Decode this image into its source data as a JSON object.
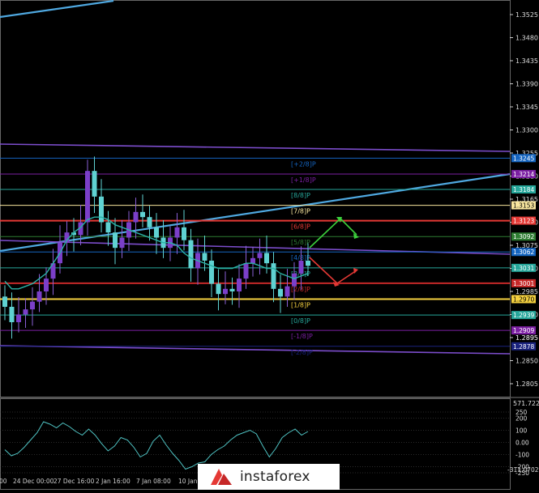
{
  "chart_data": [
    {
      "type": "candlestick",
      "instrument_note": "",
      "ylim": [
        1.2805,
        1.3545
      ],
      "price_scale": [
        "1.3525",
        "1.3480",
        "1.3435",
        "1.3390",
        "1.3345",
        "1.3300",
        "1.3255",
        "1.3210",
        "1.3165",
        "1.3120",
        "1.3075",
        "1.3030",
        "1.2985",
        "1.2940",
        "1.2895",
        "1.2850",
        "1.2805"
      ],
      "x_labels": [
        "24 Dec 00:00",
        "27 Dec 16:00",
        "2 Jan 16:00",
        "7 Jan 08:00",
        "10 Jan"
      ],
      "x_label_cut": "00",
      "murrey_levels": [
        {
          "label": "[+2/8]P",
          "price": 1.3245,
          "tag": "1.3245",
          "color": "#1565c0"
        },
        {
          "label": "[+1/8]P",
          "price": 1.3214,
          "tag": "1.3214",
          "color": "#7b1fa2"
        },
        {
          "label": "[8/8]P",
          "price": 1.3184,
          "tag": "1.3184",
          "color": "#26a69a"
        },
        {
          "label": "[7/8]P",
          "price": 1.3153,
          "tag": "1.3153",
          "color": "#f9e79f"
        },
        {
          "label": "[6/8]P",
          "price": 1.3123,
          "tag": "1.3123",
          "color": "#e53935"
        },
        {
          "label": "[5/8]P",
          "price": 1.3092,
          "tag": "1.3092",
          "color": "#2e7d32"
        },
        {
          "label": "[4/8]P",
          "price": 1.3062,
          "tag": "1.3062",
          "color": "#1565c0"
        },
        {
          "label": "[3/8]P",
          "price": 1.3031,
          "tag": "1.3031",
          "color": "#26a69a"
        },
        {
          "label": "[2/8]P",
          "price": 1.3001,
          "tag": "1.3001",
          "color": "#c62828"
        },
        {
          "label": "[1/8]P",
          "price": 1.297,
          "tag": "1.2970",
          "color": "#f4d03f"
        },
        {
          "label": "[0/8]P",
          "price": 1.2939,
          "tag": "1.2939",
          "color": "#26a69a"
        },
        {
          "label": "[-1/8]P",
          "price": 1.2909,
          "tag": "1.2909",
          "color": "#7b1fa2"
        },
        {
          "label": "[-2/8]P",
          "price": 1.2878,
          "tag": "1.2878",
          "color": "#1a237e"
        }
      ],
      "candles_close": [
        1.2955,
        1.2925,
        1.294,
        1.295,
        1.2965,
        1.2985,
        1.301,
        1.304,
        1.308,
        1.31,
        1.3095,
        1.312,
        1.322,
        1.317,
        1.312,
        1.31,
        1.307,
        1.309,
        1.312,
        1.314,
        1.313,
        1.311,
        1.309,
        1.307,
        1.309,
        1.311,
        1.3085,
        1.303,
        1.306,
        1.3045,
        1.3,
        1.298,
        1.299,
        1.2985,
        1.301,
        1.304,
        1.305,
        1.306,
        1.304,
        1.299,
        1.2975,
        1.2995,
        1.302,
        1.3045,
        1.3035
      ],
      "moving_average": [
        1.3005,
        1.299,
        1.299,
        1.2995,
        1.3,
        1.301,
        1.302,
        1.304,
        1.306,
        1.3085,
        1.31,
        1.311,
        1.3125,
        1.313,
        1.313,
        1.3125,
        1.3115,
        1.311,
        1.3105,
        1.31,
        1.3095,
        1.309,
        1.3085,
        1.308,
        1.308,
        1.3075,
        1.306,
        1.305,
        1.3045,
        1.304,
        1.3035,
        1.303,
        1.303,
        1.303,
        1.3035,
        1.304,
        1.304,
        1.3035,
        1.303,
        1.303,
        1.302,
        1.3015,
        1.301,
        1.3015,
        1.302
      ]
    },
    {
      "type": "line",
      "indicator": "cci",
      "header_value": "571.7224",
      "footer_value": "-311.0702",
      "ylim": [
        -311.07,
        571.72
      ],
      "y_ticks": [
        "250",
        "200",
        "100",
        "0.00",
        "-100",
        "-200",
        "-250"
      ],
      "values": [
        -60,
        -110,
        -90,
        -40,
        20,
        80,
        170,
        150,
        120,
        160,
        130,
        90,
        60,
        110,
        60,
        -10,
        -70,
        -30,
        40,
        20,
        -40,
        -120,
        -90,
        10,
        60,
        -20,
        -90,
        -150,
        -220,
        -200,
        -170,
        -160,
        -100,
        -60,
        -30,
        20,
        60,
        80,
        100,
        70,
        -30,
        -120,
        -50,
        40,
        80,
        110,
        60,
        90
      ]
    },
    {
      "type": "trendline",
      "purple_channel_tag": "1.2895"
    }
  ],
  "logo": {
    "text": "instaforex"
  }
}
